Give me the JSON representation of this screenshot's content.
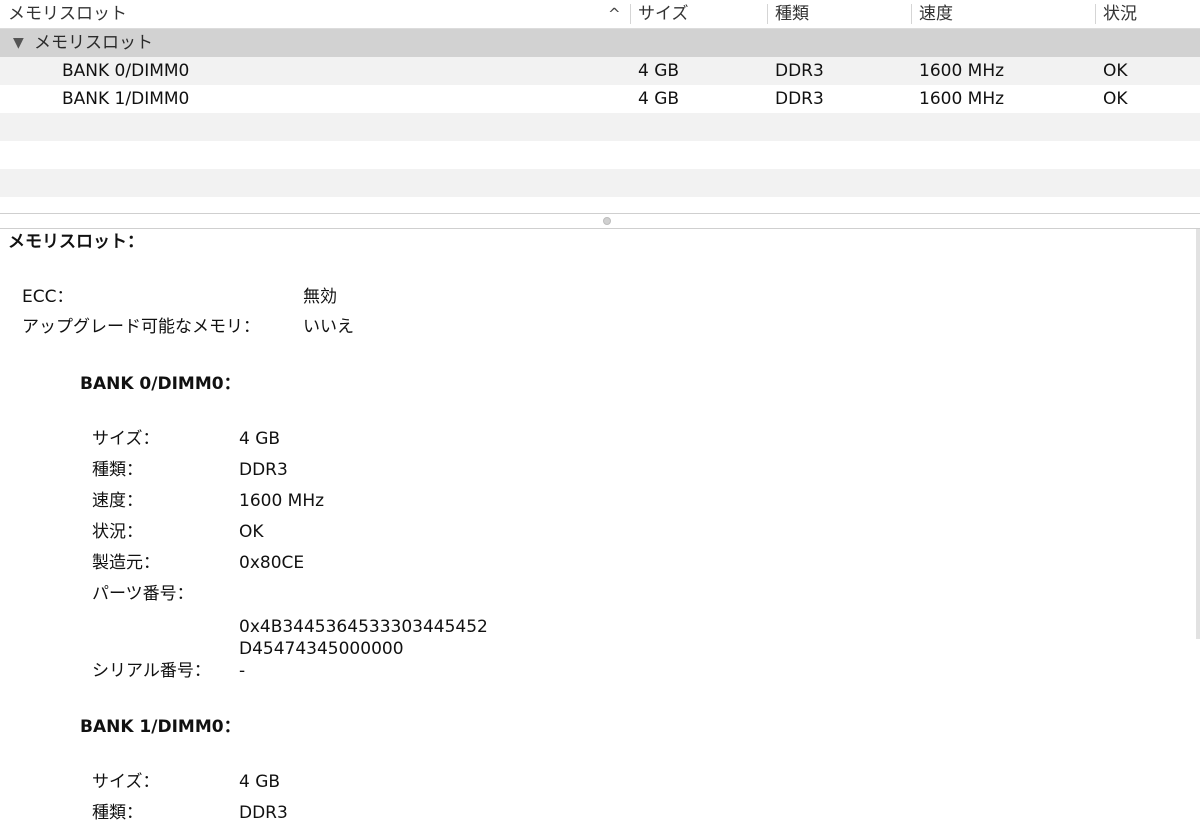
{
  "table": {
    "columns": [
      {
        "label": "メモリスロット"
      },
      {
        "label": "サイズ"
      },
      {
        "label": "種類"
      },
      {
        "label": "速度"
      },
      {
        "label": "状況"
      }
    ],
    "group_label": "メモリスロット",
    "disclosure_glyph": "▼",
    "sort_glyph": "^",
    "rows": [
      {
        "slot": "BANK 0/DIMM0",
        "size": "4 GB",
        "type": "DDR3",
        "speed": "1600 MHz",
        "status": "OK"
      },
      {
        "slot": "BANK 1/DIMM0",
        "size": "4 GB",
        "type": "DDR3",
        "speed": "1600 MHz",
        "status": "OK"
      }
    ]
  },
  "detail": {
    "heading": "メモリスロット：",
    "summary": [
      {
        "label": "ECC：",
        "value": "無効"
      },
      {
        "label": "アップグレード可能なメモリ：",
        "value": "いいえ"
      }
    ],
    "banks": [
      {
        "title": "BANK 0/DIMM0：",
        "size_label": "サイズ：",
        "size": "4 GB",
        "type_label": "種類：",
        "type": "DDR3",
        "speed_label": "速度：",
        "speed": "1600 MHz",
        "status_label": "状況：",
        "status": "OK",
        "maker_label": "製造元：",
        "maker": "0x80CE",
        "part_label": "パーツ番号：",
        "part_line1": "0x4B3445364533303445452",
        "part_line2": "D45474345000000",
        "serial_label": "シリアル番号：",
        "serial": "-"
      },
      {
        "title": "BANK 1/DIMM0：",
        "size_label": "サイズ：",
        "size": "4 GB",
        "type_label": "種類：",
        "type": "DDR3"
      }
    ]
  },
  "colors": {
    "group_row": "#d2d2d2",
    "stripe_row": "#f2f2f2",
    "background": "#ffffff"
  }
}
